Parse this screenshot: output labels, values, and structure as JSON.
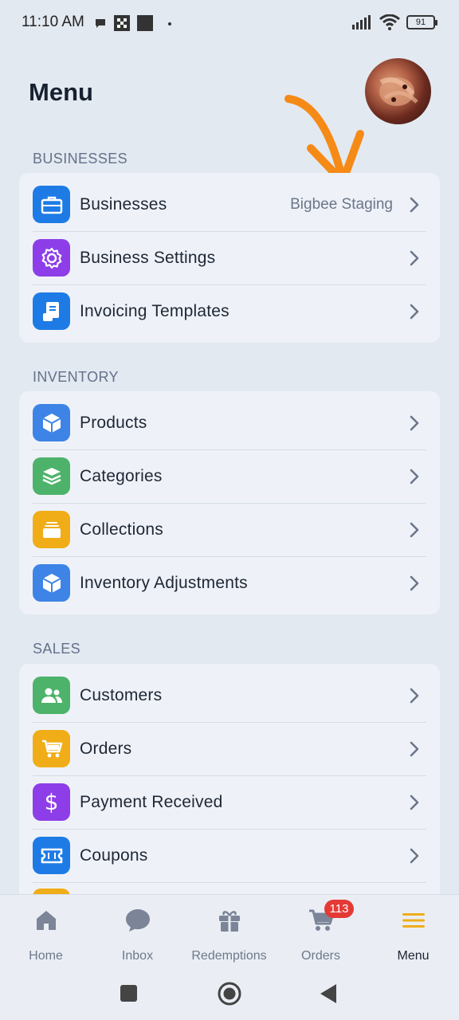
{
  "status": {
    "time": "11:10 AM",
    "battery": "91"
  },
  "header": {
    "title": "Menu"
  },
  "sections": [
    {
      "label": "BUSINESSES",
      "items": [
        {
          "label": "Businesses",
          "value": "Bigbee Staging",
          "icon": "briefcase-icon",
          "color": "#1e7be6"
        },
        {
          "label": "Business Settings",
          "icon": "gear-icon",
          "color": "#8d3ee8"
        },
        {
          "label": "Invoicing Templates",
          "icon": "invoice-icon",
          "color": "#1e7be6"
        }
      ]
    },
    {
      "label": "INVENTORY",
      "items": [
        {
          "label": "Products",
          "icon": "box-icon",
          "color": "#3d84e6"
        },
        {
          "label": "Categories",
          "icon": "layers-icon",
          "color": "#4db36a"
        },
        {
          "label": "Collections",
          "icon": "collections-icon",
          "color": "#f0ad18"
        },
        {
          "label": "Inventory Adjustments",
          "icon": "box-icon",
          "color": "#3d84e6"
        }
      ]
    },
    {
      "label": "SALES",
      "items": [
        {
          "label": "Customers",
          "icon": "users-icon",
          "color": "#4db36a"
        },
        {
          "label": "Orders",
          "icon": "cart-icon",
          "color": "#f0ad18"
        },
        {
          "label": "Payment Received",
          "icon": "dollar-icon",
          "color": "#8d3ee8"
        },
        {
          "label": "Coupons",
          "icon": "ticket-icon",
          "color": "#1e7be6"
        }
      ]
    }
  ],
  "nav": {
    "items": [
      {
        "label": "Home",
        "icon": "home-icon"
      },
      {
        "label": "Inbox",
        "icon": "chat-icon"
      },
      {
        "label": "Redemptions",
        "icon": "gift-icon"
      },
      {
        "label": "Orders",
        "icon": "cart-icon",
        "badge": "113"
      },
      {
        "label": "Menu",
        "icon": "hamburger-icon",
        "active": true
      }
    ]
  },
  "colors": {
    "accent": "#f0ad18",
    "annotation": "#f58a17",
    "badge": "#e53935"
  }
}
